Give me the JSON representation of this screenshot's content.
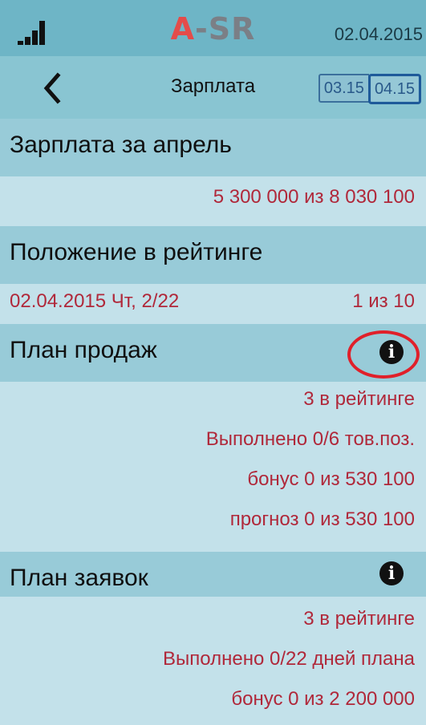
{
  "status": {
    "logo_a": "A",
    "logo_dash": "-",
    "logo_sr": "SR",
    "date": "02.04.2015",
    "signal_icon": "signal-bars-icon"
  },
  "nav": {
    "back_icon": "chevron-left-icon",
    "title": "Зарплата",
    "tabs": [
      {
        "label": "03.15",
        "active": false
      },
      {
        "label": "04.15",
        "active": true
      }
    ]
  },
  "salary": {
    "title": "Зарплата за апрель",
    "value": "5 300 000 из 8 030 100"
  },
  "rating": {
    "title": "Положение в рейтинге",
    "date_info": "02.04.2015 Чт, 2/22",
    "position": "1 из 10"
  },
  "sales_plan": {
    "title": "План продаж",
    "info_icon": "info-icon",
    "info_glyph": "i",
    "lines": [
      "3 в рейтинге",
      "Выполнено 0/6 тов.поз.",
      "бонус 0 из 530 100",
      "прогноз 0 из 530 100"
    ]
  },
  "orders_plan": {
    "title": "План заявок",
    "info_icon": "info-icon",
    "info_glyph": "i",
    "lines": [
      "3 в рейтинге",
      "Выполнено 0/22 дней плана",
      "бонус 0 из 2 200 000"
    ]
  },
  "colors": {
    "status_bar": "#6eb5c6",
    "nav_bar": "#89c5d2",
    "section_header": "#98cbd8",
    "body": "#c3e1ea",
    "value_text": "#b0283a",
    "logo_accent": "#e44c4a",
    "highlight": "#e0202a"
  }
}
